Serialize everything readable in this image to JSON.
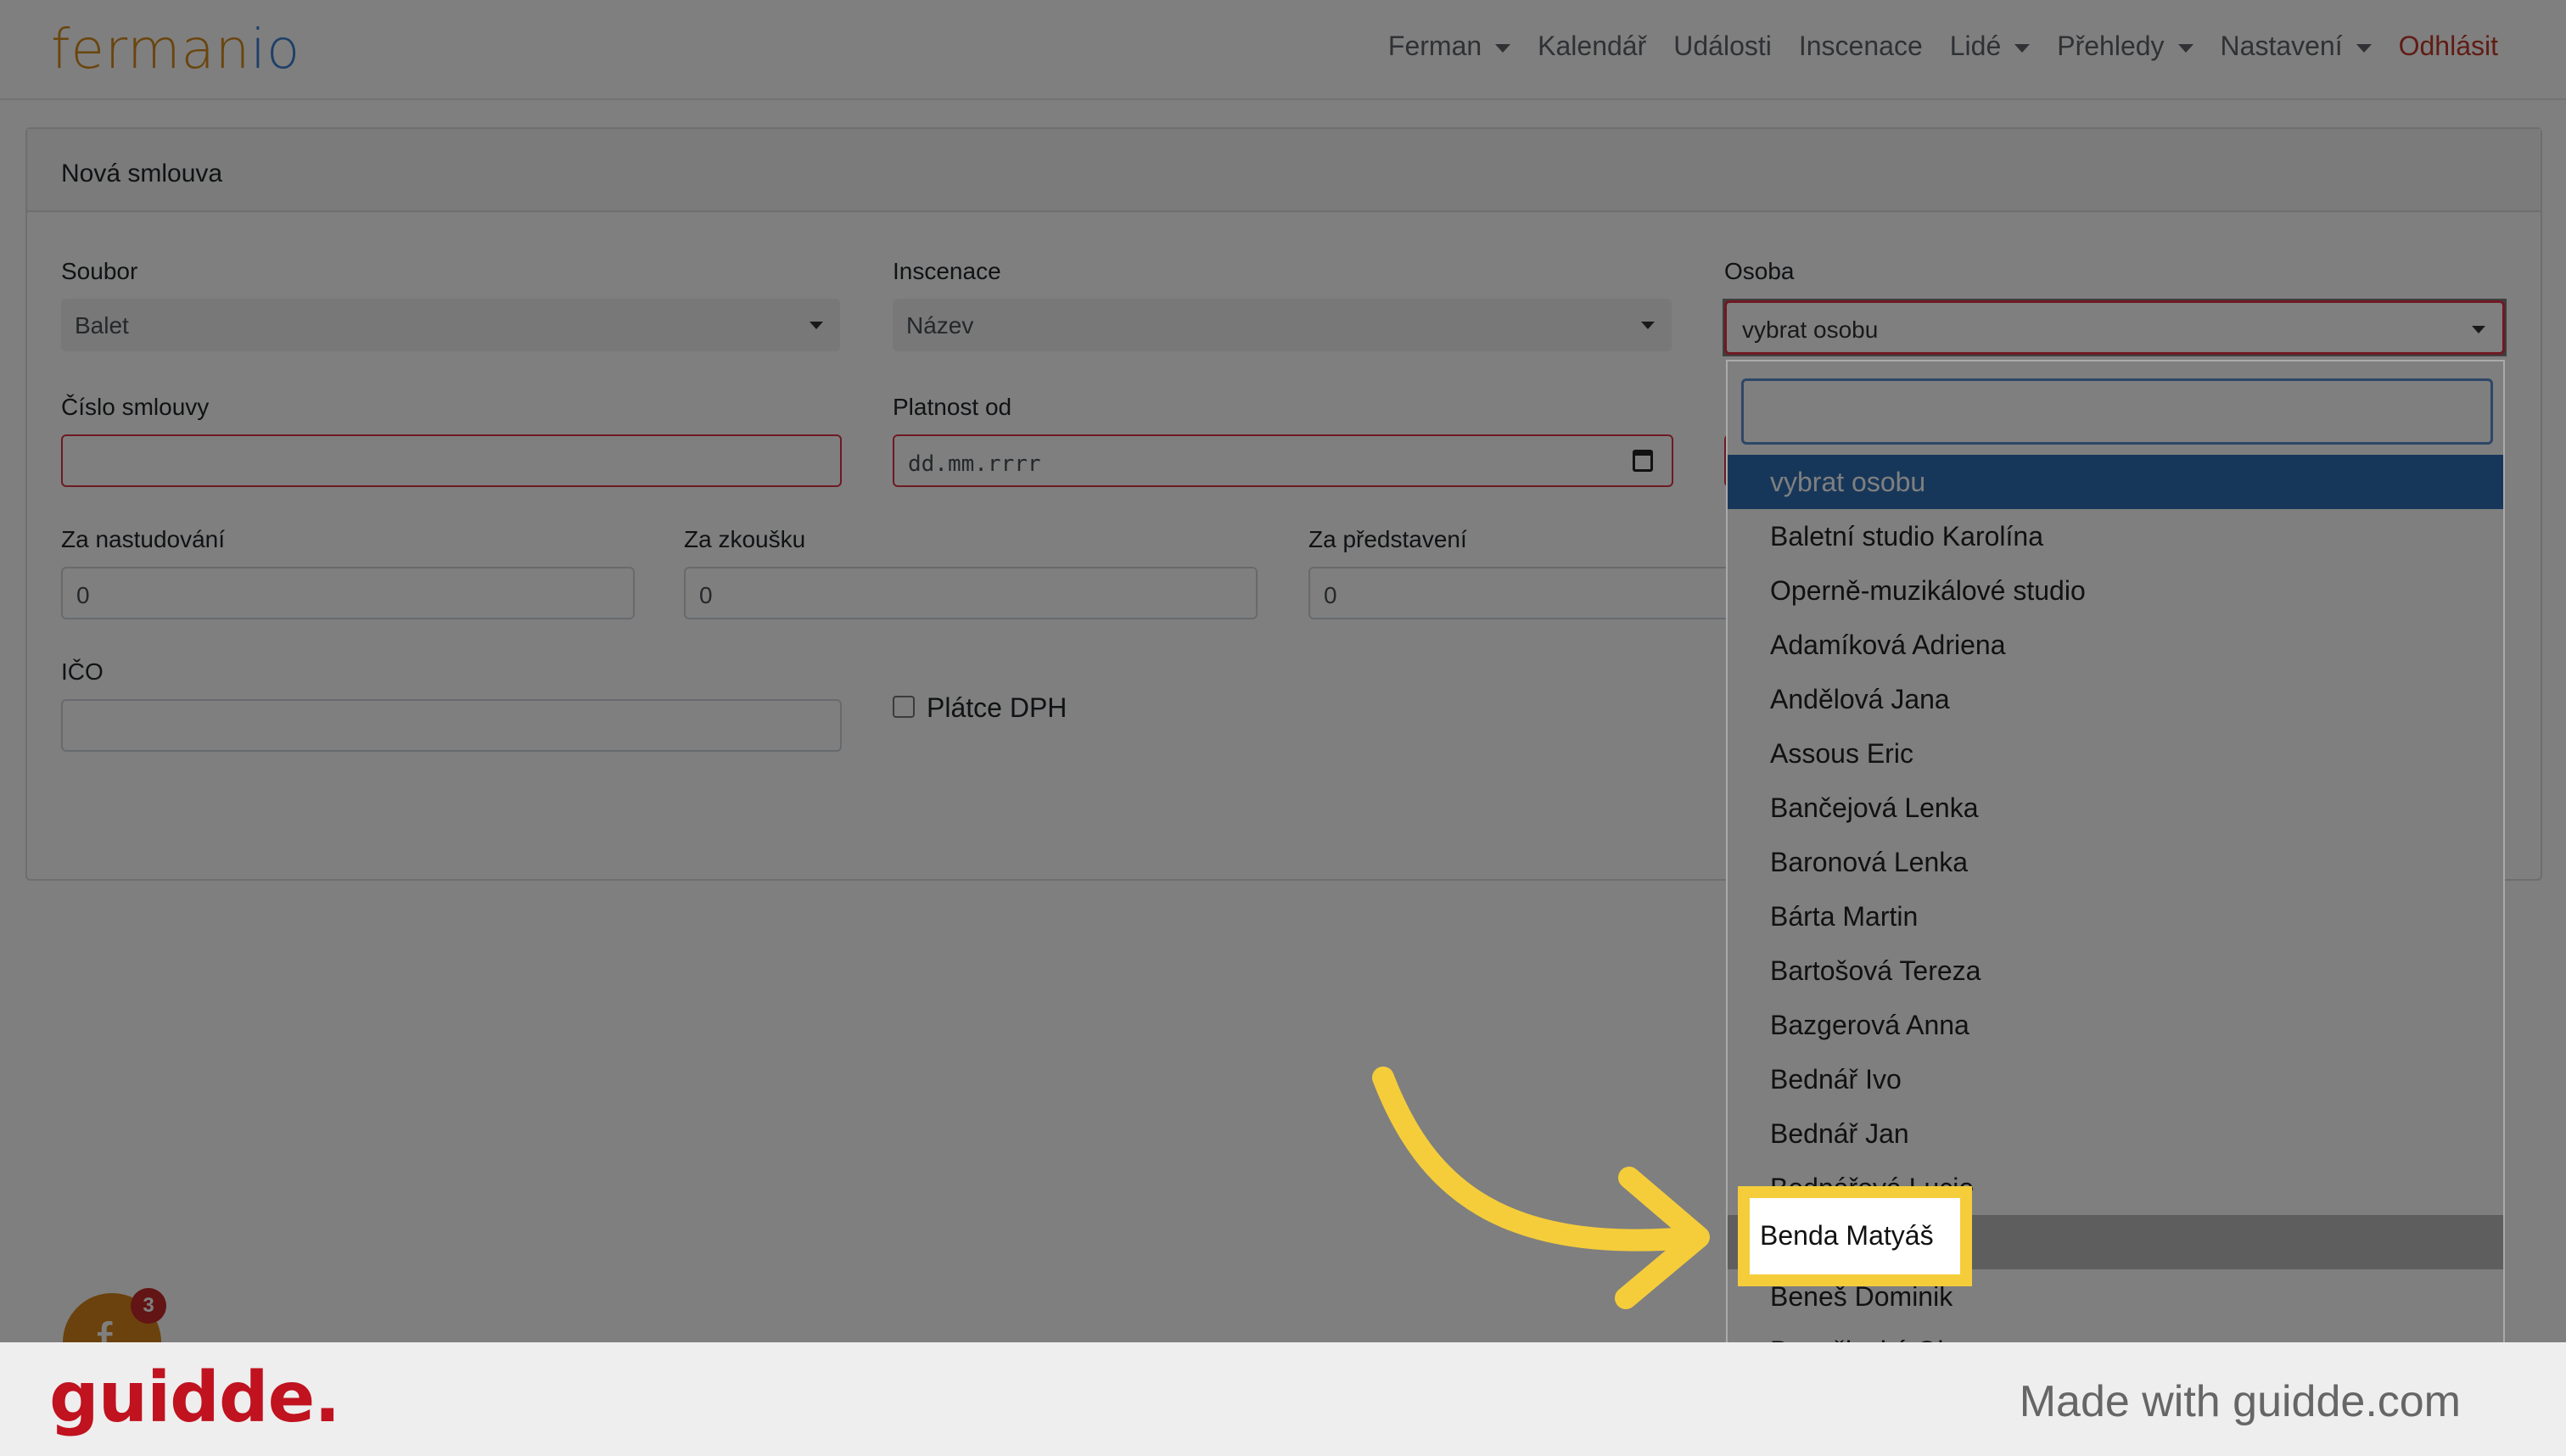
{
  "navbar": {
    "logo_part1": "ferman",
    "logo_part2": "io",
    "items": [
      {
        "label": "Ferman",
        "dropdown": true
      },
      {
        "label": "Kalendář",
        "dropdown": false
      },
      {
        "label": "Události",
        "dropdown": false
      },
      {
        "label": "Inscenace",
        "dropdown": false
      },
      {
        "label": "Lidé",
        "dropdown": true
      },
      {
        "label": "Přehledy",
        "dropdown": true
      },
      {
        "label": "Nastavení",
        "dropdown": true
      },
      {
        "label": "Odhlásit",
        "dropdown": false
      }
    ]
  },
  "card": {
    "title": "Nová smlouva"
  },
  "form": {
    "soubor_label": "Soubor",
    "soubor_value": "Balet",
    "inscenace_label": "Inscenace",
    "inscenace_value": "Název",
    "osoba_label": "Osoba",
    "osoba_value": "vybrat osobu",
    "cislo_label": "Číslo smlouvy",
    "cislo_value": "",
    "platnost_label": "Platnost od",
    "platnost_placeholder": "dd.mm.rrrr",
    "nastudovani_label": "Za nastudování",
    "nastudovani_value": "0",
    "zkousku_label": "Za zkoušku",
    "zkousku_value": "0",
    "predstaveni_label": "Za představení",
    "predstaveni_value": "0",
    "ico_label": "IČO",
    "ico_value": "",
    "dph_label": "Plátce DPH"
  },
  "dropdown": {
    "search_value": "",
    "options": [
      "vybrat osobu",
      "Baletní studio Karolína",
      "Operně-muzikálové studio",
      "Adamíková Adriena",
      "Andělová Jana",
      "Assous Eric",
      "Bančejová Lenka",
      "Baronová Lenka",
      "Bárta Martin",
      "Bartošová Tereza",
      "Bazgerová Anna",
      "Bednář Ivo",
      "Bednář Jan",
      "Bednářová Lucie",
      "Benda Matyáš",
      "Beneš Dominik",
      "Bezačinská Olga"
    ],
    "highlighted": "Benda Matyáš"
  },
  "badge": {
    "letter": "f",
    "count": "3"
  },
  "footer": {
    "brand": "guidde.",
    "made_with": "Made with guidde.com"
  },
  "colors": {
    "accent_highlight": "#f5cd3a",
    "selected_option": "#2f6fb5",
    "invalid_border": "#dc3545",
    "brand_red": "#c0121f"
  }
}
